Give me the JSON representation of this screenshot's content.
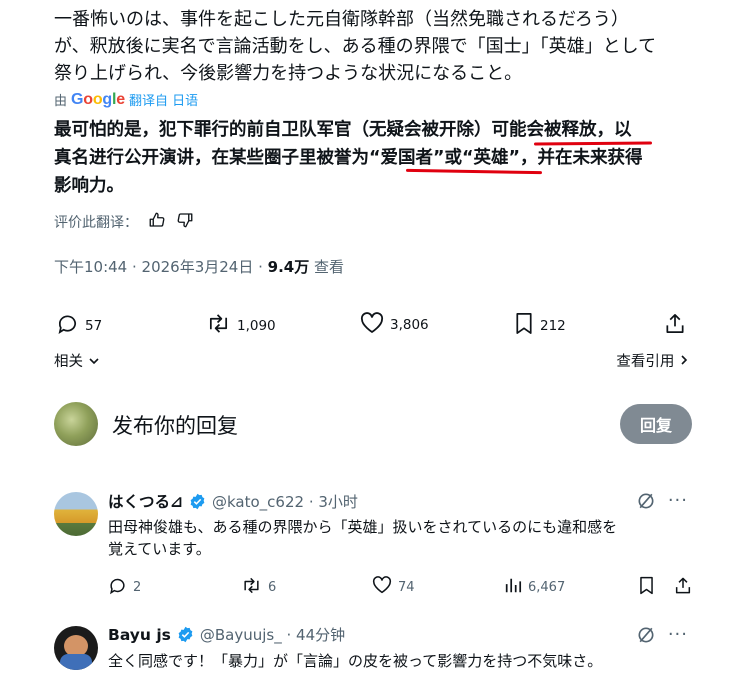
{
  "post": {
    "original_lines": [
      "一番怖いのは、事件を起こした元自衛隊幹部（当然免職されるだろう）",
      "が、釈放後に実名で言論活動をし、ある種の界隈で「国士」「英雄」として",
      "祭り上げられ、今後影響力を持つような状況になること。"
    ],
    "translated_by": "由",
    "google_label": "Google",
    "translate_link": "翻译自 日语",
    "translation_lines": [
      "最可怕的是，犯下罪行的前自卫队军官（无疑会被开除）可能会被释放，以",
      "真名进行公开演讲，在某些圈子里被誉为“爱国者”或“英雄”，并在未来获得",
      "影响力。"
    ],
    "rate_label": "评价此翻译：",
    "timestamp": "下午10:44 · 2026年3月24日 · ",
    "views_count": "9.4万",
    "views_label": " 查看",
    "replies": "57",
    "reposts": "1,090",
    "likes": "3,806",
    "bookmarks": "212",
    "related_label": "相关",
    "quotes_label": "查看引用"
  },
  "composer": {
    "placeholder": "发布你的回复",
    "reply_button": "回复"
  },
  "replies_list": [
    {
      "name": "はくつる⊿",
      "handle": "@kato_c622 · 3小时",
      "text_lines": [
        "田母神俊雄も、ある種の界隈から「英雄」扱いをされているのにも違和感を",
        "覚えています。"
      ],
      "replies": "2",
      "reposts": "6",
      "likes": "74",
      "views": "6,467"
    },
    {
      "name": "Bayu js",
      "handle": "@Bayuujs_ · 44分钟",
      "text_lines": [
        "全く同感です！「暴力」が「言論」の皮を被って影響力を持つ不気味さ。"
      ]
    }
  ],
  "colors": {
    "text": "#0f1419",
    "secondary": "#536471",
    "link": "#1d9bf0",
    "underline_annotation": "#e0000f",
    "reply_button": "#808a93"
  }
}
